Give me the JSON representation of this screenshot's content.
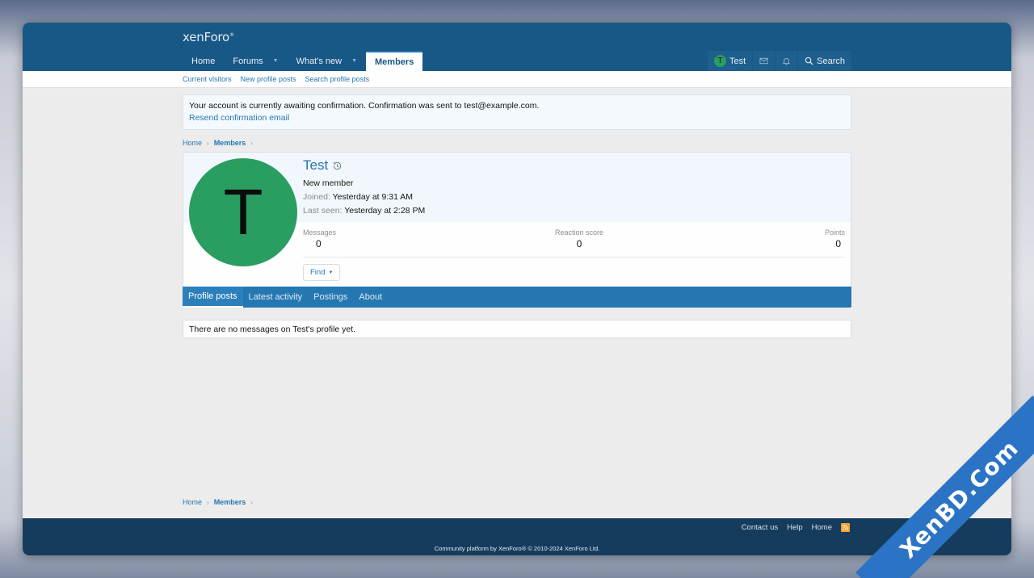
{
  "brand": {
    "logo_text": "xenForo",
    "logo_sup": "®"
  },
  "nav": {
    "tabs": [
      {
        "label": "Home"
      },
      {
        "label": "Forums"
      },
      {
        "label": "What's new"
      },
      {
        "label": "Members"
      }
    ],
    "user_label": "Test",
    "user_initial": "T",
    "search_label": "Search"
  },
  "subnav": {
    "items": [
      {
        "label": "Current visitors"
      },
      {
        "label": "New profile posts"
      },
      {
        "label": "Search profile posts"
      }
    ]
  },
  "notice": {
    "text": "Your account is currently awaiting confirmation. Confirmation was sent to test@example.com.",
    "link": "Resend confirmation email"
  },
  "breadcrumb": {
    "home": "Home",
    "members": "Members"
  },
  "profile": {
    "initial": "T",
    "name": "Test",
    "title": "New member",
    "joined_label": "Joined:",
    "joined_value": "Yesterday at 9:31 AM",
    "last_seen_label": "Last seen:",
    "last_seen_value": "Yesterday at 2:28 PM",
    "stats": {
      "messages_label": "Messages",
      "messages_value": "0",
      "reaction_label": "Reaction score",
      "reaction_value": "0",
      "points_label": "Points",
      "points_value": "0"
    },
    "find_label": "Find"
  },
  "tabs": [
    {
      "label": "Profile posts"
    },
    {
      "label": "Latest activity"
    },
    {
      "label": "Postings"
    },
    {
      "label": "About"
    }
  ],
  "empty_message": "There are no messages on Test's profile yet.",
  "footer": {
    "links": [
      {
        "label": "Contact us"
      },
      {
        "label": "Help"
      },
      {
        "label": "Home"
      }
    ],
    "copyright": "Community platform by XenForo® © 2010-2024 XenForo Ltd."
  },
  "watermark": "XenBD.Com",
  "colors": {
    "header": "#185886",
    "accent": "#2577b1",
    "avatar": "#2a9d61",
    "footer": "#163c5d"
  }
}
